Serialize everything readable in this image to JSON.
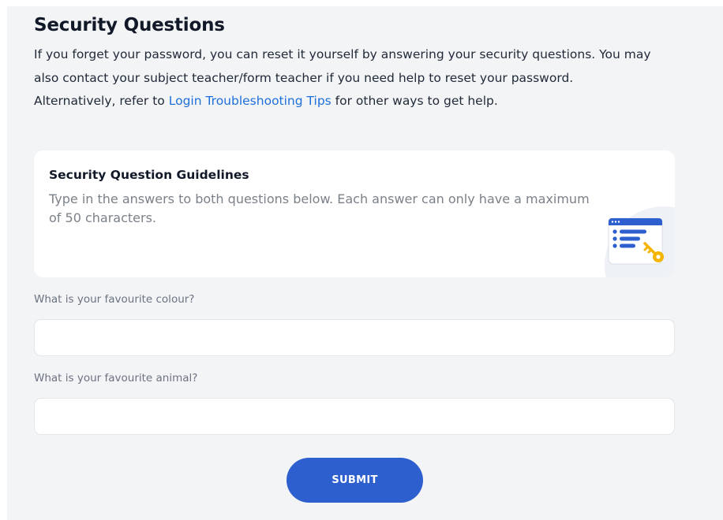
{
  "page": {
    "title": "Security Questions",
    "intro": {
      "line1": "If you forget your password, you can reset it yourself by answering your security questions. You may also contact your subject teacher/form teacher if you need help to reset your password.",
      "alt_prefix": "Alternatively, refer to ",
      "alt_link": "Login Troubleshooting Tips",
      "alt_suffix": " for other ways to get help."
    }
  },
  "guidelines": {
    "title": "Security Question Guidelines",
    "body": "Type in the answers to both questions below. Each answer can only have a maximum of 50 characters.",
    "icon": "security-key-document-icon"
  },
  "form": {
    "question1": {
      "label": "What is your favourite colour?",
      "value": "",
      "placeholder": ""
    },
    "question2": {
      "label": "What is your favourite animal?",
      "value": "",
      "placeholder": ""
    },
    "submit_label": "SUBMIT"
  },
  "colors": {
    "accent": "#2e5fcf",
    "link": "#1d6fdc",
    "panel_bg": "#f3f4f6",
    "key": "#f5b400"
  }
}
